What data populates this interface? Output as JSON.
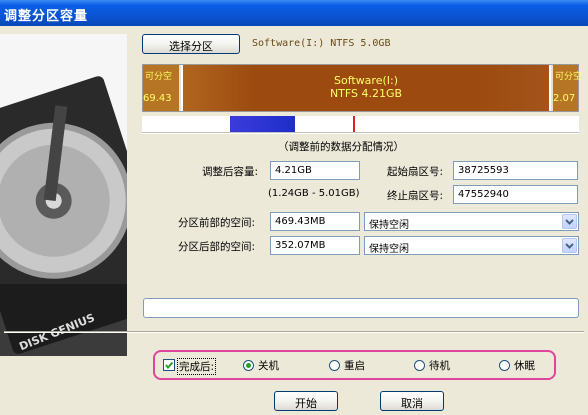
{
  "window": {
    "title": "调整分区容量"
  },
  "top": {
    "select_button": "选择分区",
    "partition_info": "Software(I:) NTFS 5.0GB"
  },
  "diskbar": {
    "left_label_top": "可分空",
    "left_label_bottom": "69.43",
    "center_name": "Software(I:)",
    "center_info": "NTFS 4.21GB",
    "right_label_top": "可分空",
    "right_label_bottom": "2.07",
    "colors": {
      "main": "#9c4a10",
      "side": "#ac6a20",
      "text": "#ffff66",
      "usage_blue": "#1e2ec8",
      "marker_red": "#e02020"
    }
  },
  "section_title": "（调整前的数据分配情况）",
  "form": {
    "new_size_label": "调整后容量:",
    "new_size_value": "4.21GB",
    "range_text": "(1.24GB - 5.01GB)",
    "start_sector_label": "起始扇区号:",
    "start_sector_value": "38725593",
    "end_sector_label": "终止扇区号:",
    "end_sector_value": "47552940",
    "before_space_label": "分区前部的空间:",
    "before_space_value": "469.43MB",
    "before_option": "保持空闲",
    "after_space_label": "分区后部的空间:",
    "after_space_value": "352.07MB",
    "after_option": "保持空闲"
  },
  "progress": {
    "text": ""
  },
  "finish": {
    "checkbox_label": "完成后:",
    "checked": true,
    "options": [
      "关机",
      "重启",
      "待机",
      "休眠"
    ],
    "selected": "关机"
  },
  "buttons": {
    "start": "开始",
    "cancel": "取消"
  },
  "logo_text": "DISK GENIUS"
}
